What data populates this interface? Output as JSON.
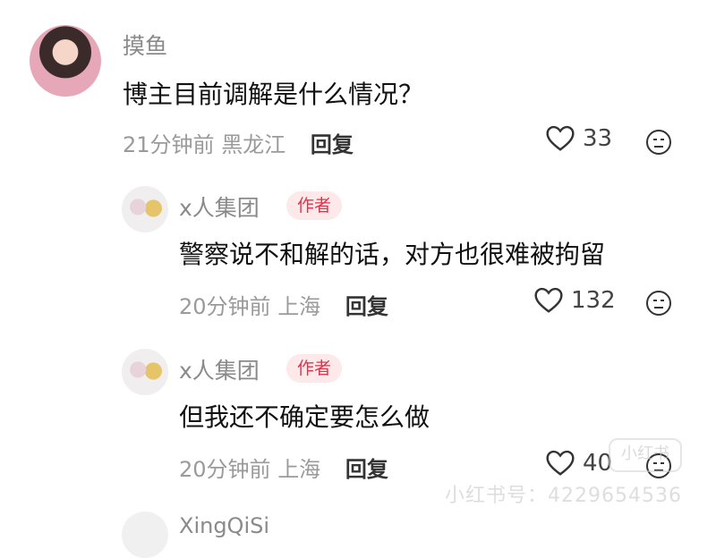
{
  "comments": [
    {
      "username": "摸鱼",
      "text": "博主目前调解是什么情况？",
      "time": "21分钟前",
      "location": "黑龙江",
      "reply_label": "回复",
      "likes": "33",
      "author_badge": ""
    },
    {
      "username": "x人集团",
      "text": "警察说不和解的话，对方也很难被拘留",
      "time": "20分钟前",
      "location": "上海",
      "reply_label": "回复",
      "likes": "132",
      "author_badge": "作者"
    },
    {
      "username": "x人集团",
      "text": "但我还不确定要怎么做",
      "time": "20分钟前",
      "location": "上海",
      "reply_label": "回复",
      "likes": "40",
      "author_badge": "作者"
    }
  ],
  "next_comment": {
    "username": "XingQiSi"
  },
  "watermark": {
    "logo_text": "小红书",
    "id_text": "小红书号：4229654536"
  },
  "icons": {
    "like": "heart-icon",
    "dislike": "dislike-face-icon"
  }
}
